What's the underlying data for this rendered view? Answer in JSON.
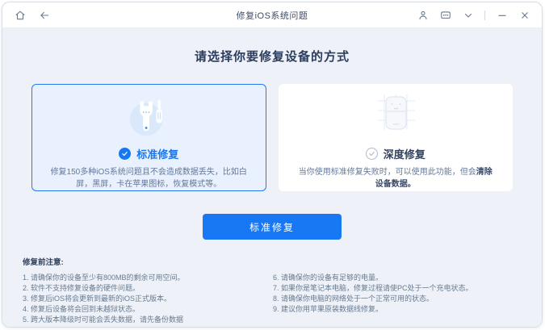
{
  "titlebar": {
    "title": "修复iOS系统问题",
    "icons": [
      "home-icon",
      "back-arrow-icon",
      "account-icon",
      "feedback-icon",
      "chevron-down-icon",
      "minimize-icon",
      "close-icon"
    ]
  },
  "main": {
    "heading": "请选择你要修复设备的方式",
    "cards": [
      {
        "id": "standard",
        "label": "标准修复",
        "selected": true,
        "icon": "wrench-screwdriver-icon",
        "description": "修复150多种iOS系统问题且不会造成数据丢失，比如白屏，黑屏，卡在苹果图标，恢复模式等。"
      },
      {
        "id": "deep",
        "label": "深度修复",
        "selected": false,
        "icon": "device-icon",
        "description_prefix": "当你使用标准修复失败时，可以使用此功能，但会",
        "description_bold": "清除设备数据。"
      }
    ],
    "action_button": "标准修复"
  },
  "notes": {
    "title": "修复前注意:",
    "left": [
      "1. 请确保你的设备至少有800MB的剩余可用空间。",
      "2. 软件不支持修复设备的硬件问题。",
      "3. 修复后iOS将会更新到最新的iOS正式版本。",
      "4. 修复后设备将会回到未越狱状态。",
      "5. 跨大版本降级时可能会丢失数据，请先备份数据"
    ],
    "right": [
      "6. 请确保你的设备有足够的电量。",
      "7. 如果你是笔记本电脑，修复过程请使PC处于一个充电状态。",
      "8. 请确保你电脑的网络处于一个正常可用的状态。",
      "9. 建议你用苹果原装数据线修复。"
    ]
  },
  "colors": {
    "accent": "#1877F2",
    "selected_card_bg": "#E8F1FD",
    "selected_card_border": "#2478F2",
    "main_bg": "#EEF2F8",
    "heading_text": "#2B3C5E",
    "note_text": "#687A90"
  }
}
